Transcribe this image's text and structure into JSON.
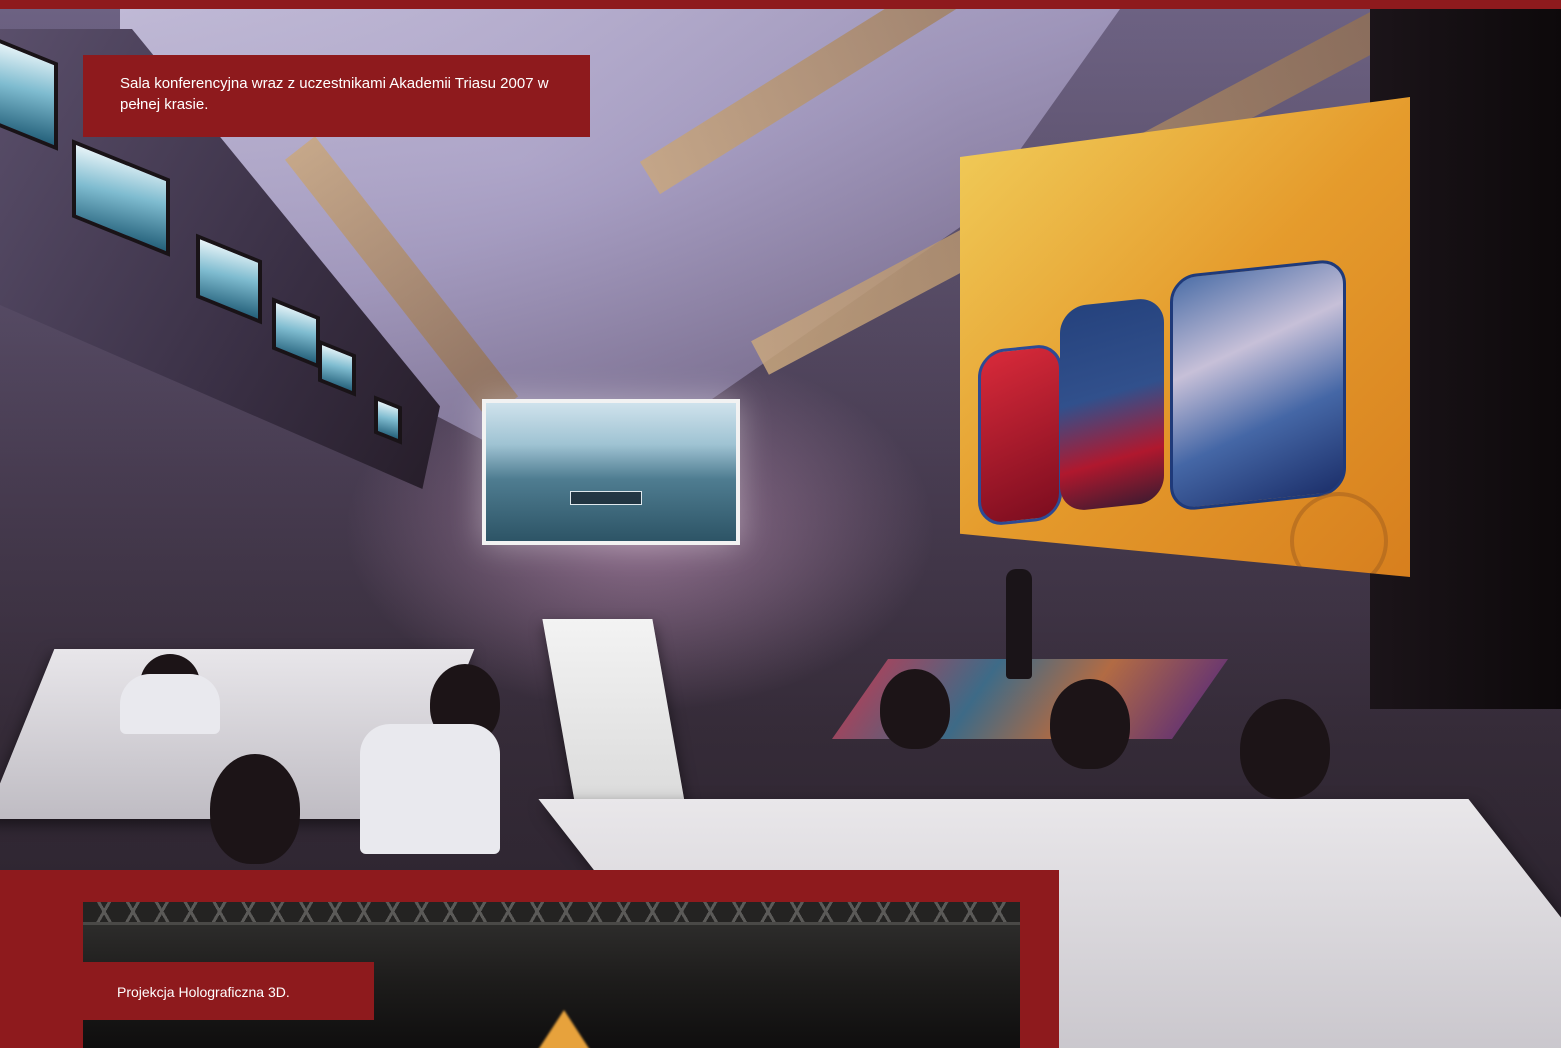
{
  "captions": {
    "main": "Sala konferencyjna wraz z uczestnikami Akademii Triasu 2007 w pełnej krasie.",
    "inset": "Projekcja Holograficzna 3D."
  },
  "colors": {
    "accent": "#8e1a1d",
    "caption_text": "#ffffff"
  }
}
